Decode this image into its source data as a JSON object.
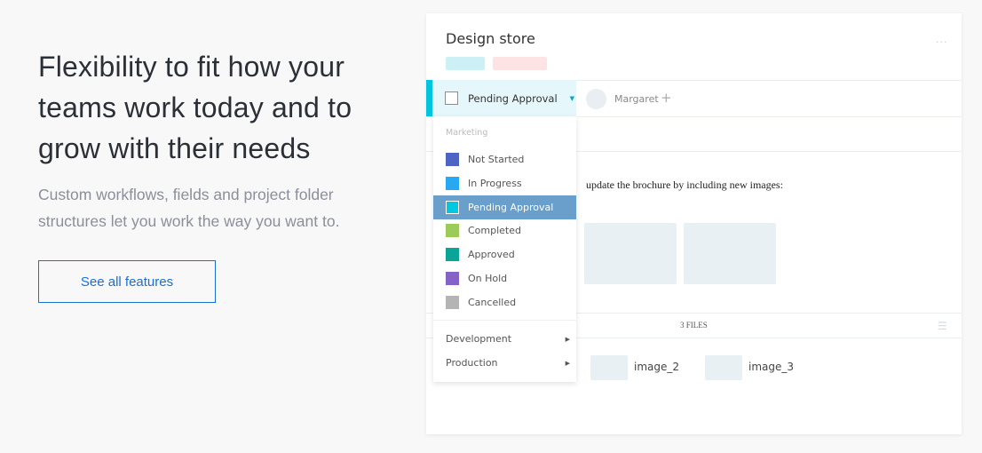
{
  "hero": {
    "heading": "Flexibility to fit how your teams work today and to grow with their needs",
    "subtext": "Custom workflows, fields and project folder structures let you work the way you want to.",
    "button": "See all features"
  },
  "card": {
    "title": "Design store",
    "more_icon": "ellipsis-icon",
    "tag_colors": [
      "#cdf0f6",
      "#fde3e3"
    ],
    "status": {
      "label": "Pending Approval",
      "color": "#00c5dc"
    },
    "assignee": "Margaret",
    "description": "update the brochure by including new images:",
    "files_label": "3 FILES",
    "files": [
      "image_2",
      "image_3"
    ]
  },
  "dropdown": {
    "group": "Marketing",
    "items": [
      {
        "label": "Not Started",
        "color": "#4e63c4"
      },
      {
        "label": "In Progress",
        "color": "#27a8f3"
      },
      {
        "label": "Pending Approval",
        "color": "#00c8df",
        "selected": true
      },
      {
        "label": "Completed",
        "color": "#9ccb5a"
      },
      {
        "label": "Approved",
        "color": "#0aa597"
      },
      {
        "label": "On Hold",
        "color": "#8562c8"
      },
      {
        "label": "Cancelled",
        "color": "#b4b4b4"
      }
    ],
    "submenus": [
      "Development",
      "Production"
    ]
  }
}
